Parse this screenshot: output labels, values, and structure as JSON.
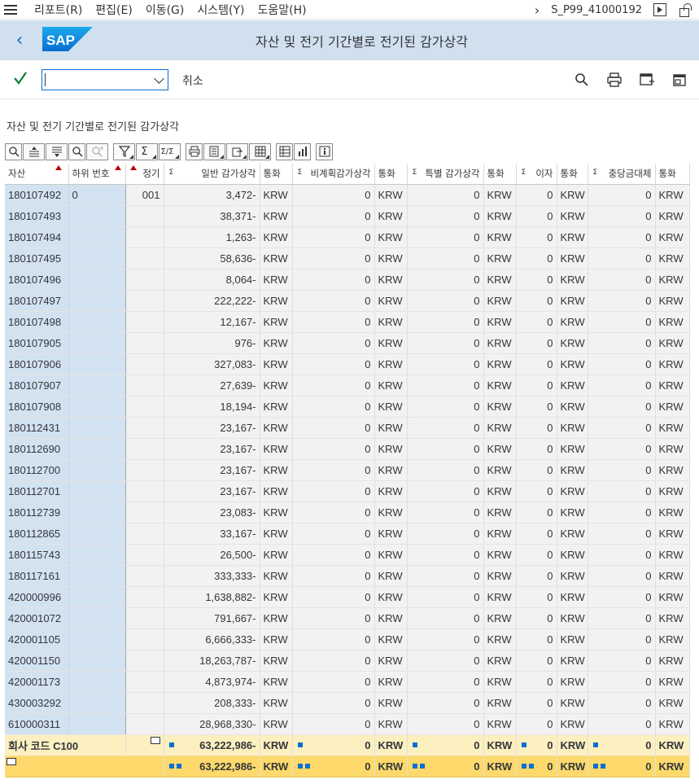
{
  "menu": {
    "items": [
      "리포트(R)",
      "편집(E)",
      "이동(G)",
      "시스템(Y)",
      "도움말(H)"
    ],
    "system_id": "S_P99_41000192"
  },
  "titlebar": {
    "title": "자산 및 전기 기간별로 전기된 감가상각",
    "logo_text": "SAP"
  },
  "toolbar": {
    "command_value": "",
    "cancel_label": "취소"
  },
  "report": {
    "title": "자산 및 전기 기간별로 전기된 감가상각"
  },
  "table": {
    "headers": {
      "asset": "자산",
      "subnumber": "하위 번호",
      "period": "정기",
      "ordinary": "일반 감가상각",
      "currency1": "통화",
      "unplanned": "비계획감가상각",
      "currency2": "통화",
      "special": "특별 감가상각",
      "currency3": "통화",
      "interest": "이자",
      "currency4": "통화",
      "reserve": "충당금대체",
      "currency5": "통화"
    },
    "rows": [
      {
        "asset": "180107492",
        "sub": "0",
        "period": "001",
        "ordinary": "3,472-",
        "cur": "KRW",
        "unplanned": "0",
        "special": "0",
        "interest": "0",
        "reserve": "0"
      },
      {
        "asset": "180107493",
        "sub": "",
        "period": "",
        "ordinary": "38,371-",
        "cur": "KRW",
        "unplanned": "0",
        "special": "0",
        "interest": "0",
        "reserve": "0"
      },
      {
        "asset": "180107494",
        "sub": "",
        "period": "",
        "ordinary": "1,263-",
        "cur": "KRW",
        "unplanned": "0",
        "special": "0",
        "interest": "0",
        "reserve": "0"
      },
      {
        "asset": "180107495",
        "sub": "",
        "period": "",
        "ordinary": "58,636-",
        "cur": "KRW",
        "unplanned": "0",
        "special": "0",
        "interest": "0",
        "reserve": "0"
      },
      {
        "asset": "180107496",
        "sub": "",
        "period": "",
        "ordinary": "8,064-",
        "cur": "KRW",
        "unplanned": "0",
        "special": "0",
        "interest": "0",
        "reserve": "0"
      },
      {
        "asset": "180107497",
        "sub": "",
        "period": "",
        "ordinary": "222,222-",
        "cur": "KRW",
        "unplanned": "0",
        "special": "0",
        "interest": "0",
        "reserve": "0"
      },
      {
        "asset": "180107498",
        "sub": "",
        "period": "",
        "ordinary": "12,167-",
        "cur": "KRW",
        "unplanned": "0",
        "special": "0",
        "interest": "0",
        "reserve": "0"
      },
      {
        "asset": "180107905",
        "sub": "",
        "period": "",
        "ordinary": "976-",
        "cur": "KRW",
        "unplanned": "0",
        "special": "0",
        "interest": "0",
        "reserve": "0"
      },
      {
        "asset": "180107906",
        "sub": "",
        "period": "",
        "ordinary": "327,083-",
        "cur": "KRW",
        "unplanned": "0",
        "special": "0",
        "interest": "0",
        "reserve": "0"
      },
      {
        "asset": "180107907",
        "sub": "",
        "period": "",
        "ordinary": "27,639-",
        "cur": "KRW",
        "unplanned": "0",
        "special": "0",
        "interest": "0",
        "reserve": "0"
      },
      {
        "asset": "180107908",
        "sub": "",
        "period": "",
        "ordinary": "18,194-",
        "cur": "KRW",
        "unplanned": "0",
        "special": "0",
        "interest": "0",
        "reserve": "0"
      },
      {
        "asset": "180112431",
        "sub": "",
        "period": "",
        "ordinary": "23,167-",
        "cur": "KRW",
        "unplanned": "0",
        "special": "0",
        "interest": "0",
        "reserve": "0"
      },
      {
        "asset": "180112690",
        "sub": "",
        "period": "",
        "ordinary": "23,167-",
        "cur": "KRW",
        "unplanned": "0",
        "special": "0",
        "interest": "0",
        "reserve": "0"
      },
      {
        "asset": "180112700",
        "sub": "",
        "period": "",
        "ordinary": "23,167-",
        "cur": "KRW",
        "unplanned": "0",
        "special": "0",
        "interest": "0",
        "reserve": "0"
      },
      {
        "asset": "180112701",
        "sub": "",
        "period": "",
        "ordinary": "23,167-",
        "cur": "KRW",
        "unplanned": "0",
        "special": "0",
        "interest": "0",
        "reserve": "0"
      },
      {
        "asset": "180112739",
        "sub": "",
        "period": "",
        "ordinary": "23,083-",
        "cur": "KRW",
        "unplanned": "0",
        "special": "0",
        "interest": "0",
        "reserve": "0"
      },
      {
        "asset": "180112865",
        "sub": "",
        "period": "",
        "ordinary": "33,167-",
        "cur": "KRW",
        "unplanned": "0",
        "special": "0",
        "interest": "0",
        "reserve": "0"
      },
      {
        "asset": "180115743",
        "sub": "",
        "period": "",
        "ordinary": "26,500-",
        "cur": "KRW",
        "unplanned": "0",
        "special": "0",
        "interest": "0",
        "reserve": "0"
      },
      {
        "asset": "180117161",
        "sub": "",
        "period": "",
        "ordinary": "333,333-",
        "cur": "KRW",
        "unplanned": "0",
        "special": "0",
        "interest": "0",
        "reserve": "0"
      },
      {
        "asset": "420000996",
        "sub": "",
        "period": "",
        "ordinary": "1,638,882-",
        "cur": "KRW",
        "unplanned": "0",
        "special": "0",
        "interest": "0",
        "reserve": "0"
      },
      {
        "asset": "420001072",
        "sub": "",
        "period": "",
        "ordinary": "791,667-",
        "cur": "KRW",
        "unplanned": "0",
        "special": "0",
        "interest": "0",
        "reserve": "0"
      },
      {
        "asset": "420001105",
        "sub": "",
        "period": "",
        "ordinary": "6,666,333-",
        "cur": "KRW",
        "unplanned": "0",
        "special": "0",
        "interest": "0",
        "reserve": "0"
      },
      {
        "asset": "420001150",
        "sub": "",
        "period": "",
        "ordinary": "18,263,787-",
        "cur": "KRW",
        "unplanned": "0",
        "special": "0",
        "interest": "0",
        "reserve": "0"
      },
      {
        "asset": "420001173",
        "sub": "",
        "period": "",
        "ordinary": "4,873,974-",
        "cur": "KRW",
        "unplanned": "0",
        "special": "0",
        "interest": "0",
        "reserve": "0"
      },
      {
        "asset": "430003292",
        "sub": "",
        "period": "",
        "ordinary": "208,333-",
        "cur": "KRW",
        "unplanned": "0",
        "special": "0",
        "interest": "0",
        "reserve": "0"
      },
      {
        "asset": "610000311",
        "sub": "",
        "period": "",
        "ordinary": "28,968,330-",
        "cur": "KRW",
        "unplanned": "0",
        "special": "0",
        "interest": "0",
        "reserve": "0"
      }
    ],
    "subtotal": {
      "label": "회사 코드 C100",
      "ordinary": "63,222,986-",
      "cur": "KRW",
      "unplanned": "0",
      "special": "0",
      "interest": "0",
      "reserve": "0"
    },
    "total": {
      "ordinary": "63,222,986-",
      "cur": "KRW",
      "unplanned": "0",
      "special": "0",
      "interest": "0",
      "reserve": "0"
    }
  },
  "colors": {
    "titlebar_bg": "#d1e0ee",
    "key_column_bg": "#d3e2f1",
    "subtotal_bg": "#fdf0c0",
    "total_bg": "#fdd96b",
    "accent": "#0a6ed1"
  }
}
